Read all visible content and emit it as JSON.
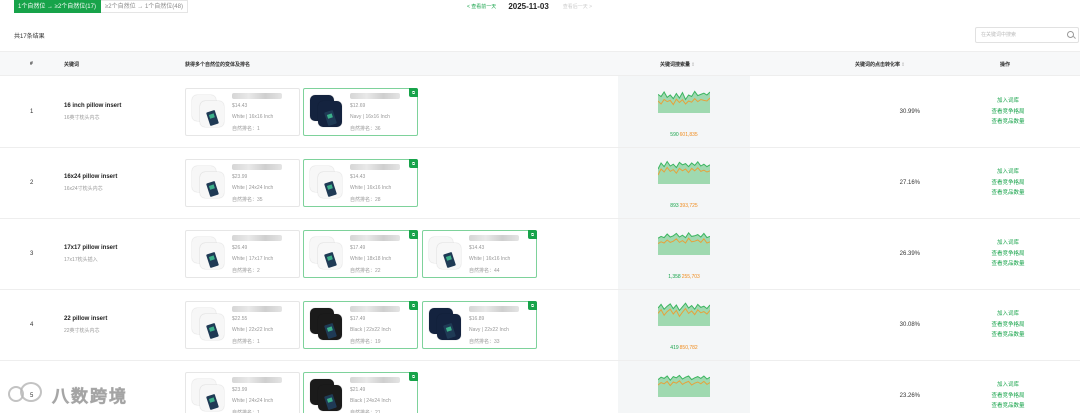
{
  "tabs": [
    {
      "label": "1个自然位 → ≥2个自然位(17)",
      "active": true
    },
    {
      "label": "≥2个自然位 → 1个自然位(48)",
      "active": false
    }
  ],
  "date_nav": {
    "prev_label": "< 查看前一天",
    "date": "2025-11-03",
    "next_label": "查看后一天 >"
  },
  "result_count": "共17条结果",
  "search": {
    "placeholder": "在关键词中搜索",
    "value": ""
  },
  "columns": {
    "index": "#",
    "keyword": "关键词",
    "variants": "获得多个自然位的变体及排名",
    "search_volume": "关键词搜索量",
    "ctr": "关键词的点击转化率",
    "actions": "操作"
  },
  "sort_glyph": "⇕",
  "rank_label": "自然排名：",
  "action_labels": [
    "加入词库",
    "查看竞争格局",
    "查看竞品数量"
  ],
  "colors": {
    "accent_green": "#17a34a",
    "volume_orange": "#f08c1e",
    "spark_green": "#3cb560",
    "spark_orange": "#e6a23c"
  },
  "rows": [
    {
      "index": "1",
      "keyword": "16 inch pillow insert",
      "keyword_cn": "16英寸枕头内芯",
      "volume_green": "590",
      "volume_orange": "601,835",
      "ctr": "30.99%",
      "spark_green": [
        62,
        55,
        70,
        52,
        60,
        48,
        65,
        50,
        68,
        45,
        60,
        55,
        72,
        58,
        62,
        66,
        60,
        70
      ],
      "spark_orange": [
        40,
        30,
        45,
        38,
        42,
        28,
        46,
        35,
        44,
        30,
        40,
        36,
        48,
        38,
        45,
        42,
        40,
        50
      ],
      "variants": [
        {
          "price": "$14.43",
          "variant": "White | 16x16 Inch",
          "rank": "1",
          "color": "white",
          "highlight": false
        },
        {
          "price": "$12.69",
          "variant": "Navy | 16x16 Inch",
          "rank": "36",
          "color": "navy",
          "highlight": true
        }
      ]
    },
    {
      "index": "2",
      "keyword": "16x24 pillow insert",
      "keyword_cn": "16x24寸枕头内芯",
      "volume_green": "893",
      "volume_orange": "393,725",
      "ctr": "27.16%",
      "spark_green": [
        50,
        70,
        58,
        75,
        60,
        66,
        55,
        72,
        64,
        68,
        58,
        70,
        62,
        74,
        60,
        66,
        58,
        64
      ],
      "spark_orange": [
        30,
        50,
        40,
        55,
        42,
        48,
        36,
        52,
        44,
        50,
        38,
        52,
        44,
        54,
        42,
        46,
        40,
        44
      ],
      "variants": [
        {
          "price": "$23.99",
          "variant": "White | 24x24 Inch",
          "rank": "35",
          "color": "white",
          "highlight": false
        },
        {
          "price": "$14.43",
          "variant": "White | 16x16 Inch",
          "rank": "28",
          "color": "white",
          "highlight": true
        }
      ]
    },
    {
      "index": "3",
      "keyword": "17x17 pillow insert",
      "keyword_cn": "17x17枕头插入",
      "volume_green": "1,358",
      "volume_orange": "255,703",
      "ctr": "26.39%",
      "spark_green": [
        56,
        62,
        58,
        70,
        60,
        64,
        72,
        60,
        66,
        58,
        74,
        62,
        64,
        68,
        60,
        72,
        58,
        62
      ],
      "spark_orange": [
        38,
        44,
        40,
        50,
        42,
        46,
        54,
        42,
        48,
        40,
        56,
        44,
        46,
        50,
        42,
        54,
        40,
        44
      ],
      "variants": [
        {
          "price": "$26.49",
          "variant": "White | 17x17 Inch",
          "rank": "2",
          "color": "white",
          "highlight": false
        },
        {
          "price": "$17.49",
          "variant": "White | 18x18 Inch",
          "rank": "22",
          "color": "white",
          "highlight": true
        },
        {
          "price": "$14.43",
          "variant": "White | 16x16 Inch",
          "rank": "44",
          "color": "white",
          "highlight": true
        }
      ]
    },
    {
      "index": "4",
      "keyword": "22 pillow insert",
      "keyword_cn": "22英寸枕头内芯",
      "volume_green": "419",
      "volume_orange": "850,782",
      "ctr": "30.08%",
      "spark_green": [
        60,
        72,
        56,
        66,
        74,
        58,
        70,
        52,
        64,
        76,
        60,
        68,
        56,
        72,
        62,
        66,
        58,
        70
      ],
      "spark_orange": [
        42,
        54,
        36,
        48,
        56,
        40,
        52,
        32,
        46,
        58,
        42,
        50,
        38,
        54,
        44,
        48,
        40,
        52
      ],
      "variants": [
        {
          "price": "$22.55",
          "variant": "White | 22x22 Inch",
          "rank": "1",
          "color": "white",
          "highlight": false
        },
        {
          "price": "$17.49",
          "variant": "Black | 22x22 Inch",
          "rank": "19",
          "color": "black",
          "highlight": true
        },
        {
          "price": "$16.89",
          "variant": "Navy | 22x22 Inch",
          "rank": "33",
          "color": "navy",
          "highlight": true
        }
      ]
    },
    {
      "index": "5",
      "keyword": "",
      "keyword_cn": "",
      "volume_green": "",
      "volume_orange": "",
      "ctr": "23.26%",
      "spark_green": [
        58,
        66,
        62,
        70,
        56,
        68,
        64,
        72,
        60,
        66,
        70,
        58,
        64,
        68,
        62,
        70,
        60,
        66
      ],
      "spark_orange": [
        40,
        48,
        44,
        52,
        38,
        50,
        46,
        54,
        42,
        48,
        52,
        40,
        46,
        50,
        44,
        52,
        42,
        48
      ],
      "variants": [
        {
          "price": "$23.99",
          "variant": "White | 24x24 Inch",
          "rank": "1",
          "color": "white",
          "highlight": false
        },
        {
          "price": "$21.49",
          "variant": "Black | 24x24 Inch",
          "rank": "21",
          "color": "black",
          "highlight": true
        }
      ]
    }
  ],
  "watermark": "八数跨境"
}
